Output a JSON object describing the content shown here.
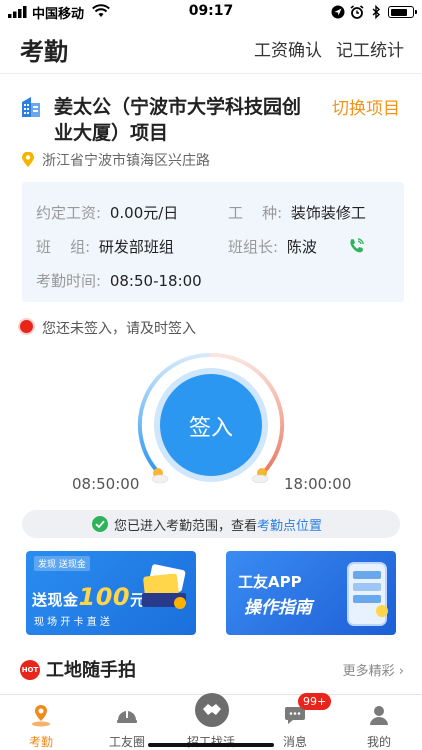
{
  "status_bar": {
    "carrier": "中国移动",
    "time": "09:17",
    "battery_level": 0.8
  },
  "nav": {
    "title": "考勤",
    "actions": [
      "工资确认",
      "记工统计"
    ]
  },
  "project": {
    "name": "姜太公（宁波市大学科技园创业大厦）项目",
    "switch_label": "切换项目",
    "location": "浙江省宁波市镇海区兴庄路"
  },
  "info": {
    "wage_label": "约定工资:",
    "wage_value": "0.00元/日",
    "trade_label": "工    种:",
    "trade_value": "装饰装修工",
    "team_label": "班    组:",
    "team_value": "研发部班组",
    "leader_label": "班组长:",
    "leader_value": "陈波",
    "hours_label": "考勤时间:",
    "hours_value": "08:50-18:00"
  },
  "alert": {
    "text": "您还未签入，请及时签入"
  },
  "checkin": {
    "button_label": "签入",
    "start_time": "08:50:00",
    "end_time": "18:00:00"
  },
  "range": {
    "text": "您已进入考勤范围，查看",
    "link": "考勤点位置"
  },
  "banners": {
    "cash": {
      "tag": "发现 送现金",
      "prefix": "送现金",
      "amount": "100",
      "unit": "元",
      "steps": "现 场 开 卡  直 送"
    },
    "guide": {
      "title": "工友APP",
      "subtitle": "操作指南"
    }
  },
  "section": {
    "badge": "HOT",
    "title": "工地随手拍",
    "more": "更多精彩 ›"
  },
  "tabs": [
    {
      "label": "考勤",
      "icon": "location-person-icon",
      "active": true
    },
    {
      "label": "工友圈",
      "icon": "helmet-icon",
      "active": false
    },
    {
      "label": "招工找活",
      "icon": "handshake-icon",
      "active": false
    },
    {
      "label": "消息",
      "icon": "chat-icon",
      "active": false,
      "badge": "99+"
    },
    {
      "label": "我的",
      "icon": "profile-icon",
      "active": false
    }
  ],
  "colors": {
    "accent_orange": "#f0941c",
    "primary_blue": "#2c97f0",
    "alert_red": "#e8241b",
    "link_blue": "#2c7fe0"
  }
}
